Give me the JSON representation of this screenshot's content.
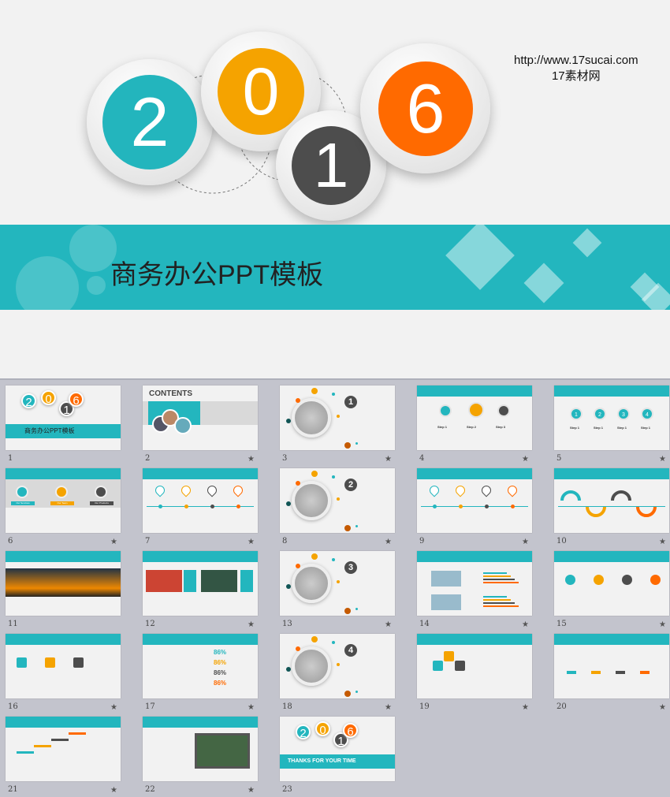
{
  "hero": {
    "digits": [
      "2",
      "0",
      "1",
      "6"
    ],
    "digit_colors": [
      "#23b5bd",
      "#f5a300",
      "#4d4d4d",
      "#ff6a00"
    ],
    "title": "商务办公PPT模板",
    "url": "http://www.17sucai.com",
    "site_name": "17素材网",
    "band_color": "#23b6be"
  },
  "slides": [
    {
      "n": "1",
      "type": "cover",
      "title": "商务办公PPT模板",
      "star": false
    },
    {
      "n": "2",
      "type": "contents",
      "text": "CONTENTS",
      "star": true
    },
    {
      "n": "3",
      "type": "section",
      "text": "1",
      "star": true
    },
    {
      "n": "4",
      "type": "steps3",
      "labels": [
        "Step 1",
        "Step 2",
        "Step 3"
      ],
      "star": true
    },
    {
      "n": "5",
      "type": "steps4",
      "labels": [
        "1",
        "2",
        "3",
        "4"
      ],
      "caption": "Step 1",
      "star": true
    },
    {
      "n": "6",
      "type": "services",
      "labels": [
        "Our Services",
        "Our Team",
        "Our Products"
      ],
      "star": true
    },
    {
      "n": "7",
      "type": "pins",
      "star": true
    },
    {
      "n": "8",
      "type": "section",
      "text": "2",
      "star": true
    },
    {
      "n": "9",
      "type": "pins",
      "star": true
    },
    {
      "n": "10",
      "type": "wave",
      "star": true
    },
    {
      "n": "11",
      "type": "photo",
      "star": false
    },
    {
      "n": "12",
      "type": "photos",
      "star": true
    },
    {
      "n": "13",
      "type": "section",
      "text": "3",
      "star": true
    },
    {
      "n": "14",
      "type": "bars",
      "star": true
    },
    {
      "n": "15",
      "type": "social",
      "star": true
    },
    {
      "n": "16",
      "type": "social-line",
      "star": true
    },
    {
      "n": "17",
      "type": "percent",
      "text": "86%",
      "star": true
    },
    {
      "n": "18",
      "type": "section",
      "text": "4",
      "star": true
    },
    {
      "n": "19",
      "type": "diamonds",
      "star": true
    },
    {
      "n": "20",
      "type": "table",
      "star": true
    },
    {
      "n": "21",
      "type": "stairs",
      "star": true
    },
    {
      "n": "22",
      "type": "laptop",
      "star": true
    },
    {
      "n": "23",
      "type": "end",
      "text": "THANKS FOR YOUR TIME",
      "star": false
    }
  ],
  "colors": {
    "teal": "#23b6be",
    "orange": "#ff6a00",
    "yellow": "#f5a300",
    "dark": "#4d4d4d"
  }
}
